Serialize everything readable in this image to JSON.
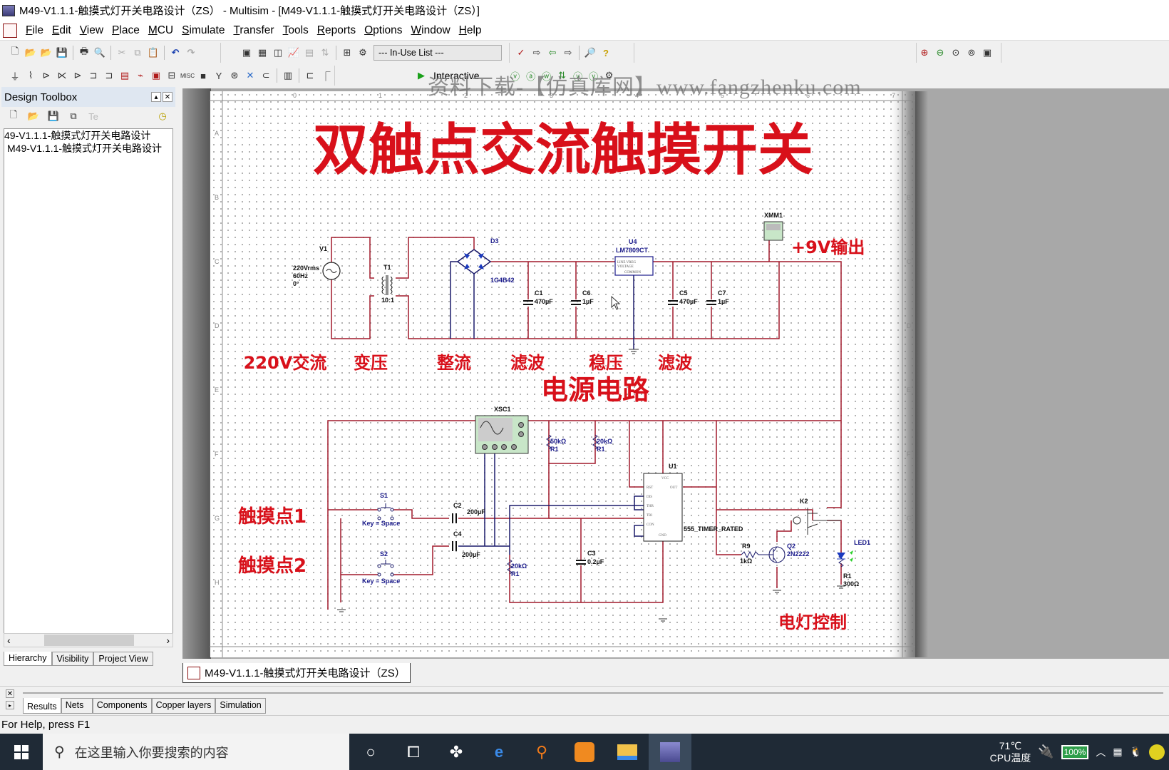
{
  "window": {
    "title": "M49-V1.1.1-触摸式灯开关电路设计（ZS） - Multisim - [M49-V1.1.1-触摸式灯开关电路设计（ZS）]"
  },
  "menu": [
    "File",
    "Edit",
    "View",
    "Place",
    "MCU",
    "Simulate",
    "Transfer",
    "Tools",
    "Reports",
    "Options",
    "Window",
    "Help"
  ],
  "toolbar": {
    "in_use_list": "--- In-Use List ---",
    "interactive_label": "Interactive"
  },
  "watermark": "资料下载-【仿真库网】www.fangzhenku.com",
  "design_toolbox": {
    "title": "Design Toolbox",
    "tree": [
      "49-V1.1.1-触摸式灯开关电路设计",
      "M49-V1.1.1-触摸式灯开关电路设计"
    ],
    "tabs": [
      "Hierarchy",
      "Visibility",
      "Project View"
    ]
  },
  "document_tab": "M49-V1.1.1-触摸式灯开关电路设计（ZS）",
  "bottom_tabs": [
    "Results",
    "Nets",
    "Components",
    "Copper layers",
    "Simulation"
  ],
  "status": "For Help, press F1",
  "schematic": {
    "title": "双触点交流触摸开关",
    "section_labels": [
      "220V交流",
      "变压",
      "整流",
      "滤波",
      "稳压",
      "滤波"
    ],
    "power_title": "电源电路",
    "output_label": "+9V输出",
    "touch1": "触摸点1",
    "touch2": "触摸点2",
    "lamp_label": "电灯控制",
    "ruler_cols": [
      "0",
      "1",
      "2",
      "3",
      "4",
      "5",
      "6",
      "7"
    ],
    "ruler_rows": [
      "A",
      "B",
      "C",
      "D",
      "E",
      "F",
      "G",
      "H"
    ],
    "components": {
      "V1": {
        "ref": "V1",
        "value": "220Vrms",
        "freq": "60Hz",
        "phase": "0°"
      },
      "T1": {
        "ref": "T1",
        "ratio": "10:1"
      },
      "D3": {
        "ref": "D3",
        "model": "1G4B42"
      },
      "C1": {
        "ref": "C1",
        "value": "470µF"
      },
      "C6": {
        "ref": "C6",
        "value": "1µF"
      },
      "U4": {
        "ref": "U4",
        "model": "LM7809CT"
      },
      "C5": {
        "ref": "C5",
        "value": "470µF"
      },
      "C7": {
        "ref": "C7",
        "value": "1µF"
      },
      "XMM1": {
        "ref": "XMM1"
      },
      "XSC1": {
        "ref": "XSC1"
      },
      "R50k": {
        "ref": "R1",
        "value": "50kΩ"
      },
      "R20k_top": {
        "ref": "R1",
        "value": "20kΩ"
      },
      "S1": {
        "ref": "S1",
        "key": "Key = Space"
      },
      "S2": {
        "ref": "S2",
        "key": "Key = Space"
      },
      "C2": {
        "ref": "C2",
        "value": "200µF"
      },
      "C4": {
        "ref": "C4",
        "value": "200µF"
      },
      "R20k_bot": {
        "ref": "R1",
        "value": "20kΩ"
      },
      "C3": {
        "ref": "C3",
        "value": "0.2µF"
      },
      "U1": {
        "ref": "U1",
        "model": "555_TIMER_RATED"
      },
      "R9": {
        "ref": "R9",
        "value": "1kΩ"
      },
      "Q2": {
        "ref": "Q2",
        "model": "2N2222"
      },
      "K2": {
        "ref": "K2"
      },
      "LED1": {
        "ref": "LED1"
      },
      "R1_led": {
        "ref": "R1",
        "value": "300Ω"
      }
    }
  },
  "taskbar": {
    "search_placeholder": "在这里输入你要搜索的内容",
    "cpu_temp": "71℃",
    "cpu_label": "CPU温度",
    "battery": "100%"
  }
}
